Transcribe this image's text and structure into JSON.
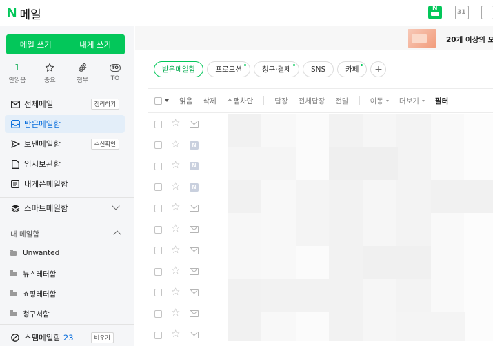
{
  "header": {
    "logo_n": "N",
    "logo_text": "메일",
    "calendar_day": "31",
    "mail_icon_n": "N"
  },
  "sidebar": {
    "write_button": "메일 쓰기",
    "write_self_button": "내게 쓰기",
    "quick": [
      {
        "icon": "unread-count",
        "value": "1",
        "label": "안읽음"
      },
      {
        "icon": "star-icon",
        "label": "중요"
      },
      {
        "icon": "paperclip-icon",
        "label": "첨부"
      },
      {
        "icon": "to-icon",
        "badge": "TO",
        "label": "TO"
      }
    ],
    "items": [
      {
        "label": "전체메일",
        "icon": "mail-icon",
        "badge": "정리하기"
      },
      {
        "label": "받은메일함",
        "icon": "inbox-icon",
        "active": true
      },
      {
        "label": "보낸메일함",
        "icon": "send-icon",
        "badge": "수신확인"
      },
      {
        "label": "임시보관함",
        "icon": "draft-icon"
      },
      {
        "label": "내게쓴메일함",
        "icon": "self-mail-icon"
      }
    ],
    "smart_mailbox": "스마트메일함",
    "my_mailbox_title": "내 메일함",
    "folders": [
      "Unwanted",
      "뉴스레터함",
      "쇼핑레터함",
      "청구서함"
    ],
    "spam": {
      "label": "스팸메일함",
      "count": "23",
      "badge": "비우기"
    }
  },
  "main": {
    "promo_text": "20개 이상의 모",
    "tabs": [
      {
        "label": "받은메일함",
        "active": true,
        "dot": false
      },
      {
        "label": "프로모션",
        "dot": true
      },
      {
        "label": "청구·결제",
        "dot": true
      },
      {
        "label": "SNS",
        "dot": false
      },
      {
        "label": "카페",
        "dot": true
      }
    ],
    "toolbar": {
      "read": "읽음",
      "delete": "삭제",
      "block_spam": "스팸차단",
      "reply": "답장",
      "reply_all": "전체답장",
      "forward": "전달",
      "move": "이동",
      "more": "더보기",
      "filter": "필터"
    },
    "rows": [
      "env",
      "n",
      "n",
      "n",
      "env",
      "env",
      "env",
      "env",
      "env",
      "env",
      "env"
    ]
  },
  "colors": {
    "brand": "#03c75a",
    "active_bg": "#e3eef9",
    "active_text": "#0a6edc"
  }
}
